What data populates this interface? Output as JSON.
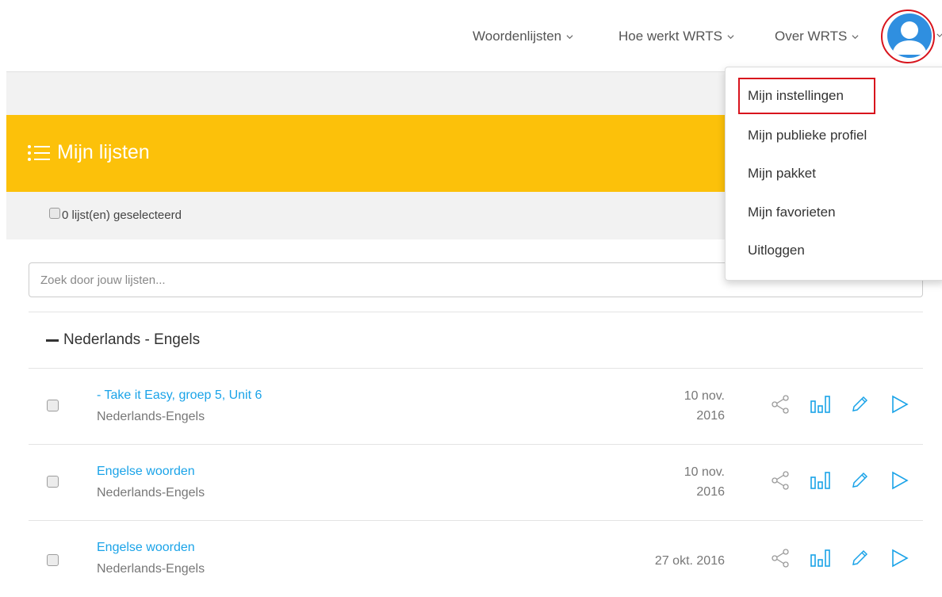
{
  "nav": {
    "items": [
      {
        "label": "Woordenlijsten"
      },
      {
        "label": "Hoe werkt WRTS"
      },
      {
        "label": "Over WRTS"
      }
    ]
  },
  "header": {
    "title": "Mijn lijsten"
  },
  "selection": {
    "label": "0 lijst(en) geselecteerd"
  },
  "search": {
    "placeholder": "Zoek door jouw lijsten..."
  },
  "group": {
    "title": "Nederlands - Engels"
  },
  "rows": [
    {
      "name": "- Take it Easy, groep 5, Unit 6",
      "lang": "Nederlands-Engels",
      "date_line1": "10 nov.",
      "date_line2": "2016"
    },
    {
      "name": "Engelse woorden",
      "lang": "Nederlands-Engels",
      "date_line1": "10 nov.",
      "date_line2": "2016"
    },
    {
      "name": "Engelse woorden",
      "lang": "Nederlands-Engels",
      "date_line1": "27 okt. 2016",
      "date_line2": ""
    }
  ],
  "user_menu": {
    "items": [
      {
        "label": "Mijn instellingen"
      },
      {
        "label": "Mijn publieke profiel"
      },
      {
        "label": "Mijn pakket"
      },
      {
        "label": "Mijn favorieten"
      },
      {
        "label": "Uitloggen"
      }
    ]
  },
  "colors": {
    "accent_yellow": "#fcc10a",
    "link_blue": "#1aa3e8",
    "highlight_red": "#d8141d",
    "avatar_blue": "#2f8fe0"
  },
  "icons": [
    "chevron-down-icon",
    "list-icon",
    "share-icon",
    "stats-icon",
    "edit-icon",
    "play-icon",
    "user-avatar-icon"
  ]
}
